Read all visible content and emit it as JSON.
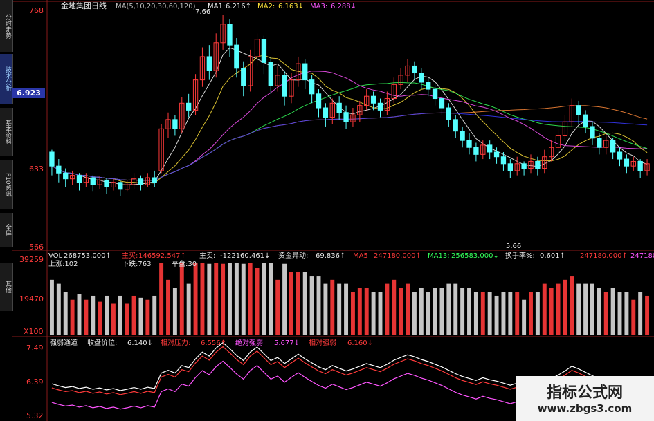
{
  "header": {
    "stock_name": "金地集团日线",
    "ma_params": "MA(5,10,20,30,60,120)",
    "ma1_label": "MA1:",
    "ma1_value": "6.216↑",
    "ma2_label": "MA2:",
    "ma2_value": "6.163↓",
    "ma3_label": "MA3:",
    "ma3_value": "6.288↓"
  },
  "price_axis": {
    "top": "768",
    "current": "6.923",
    "mid": "633",
    "bottom": "566"
  },
  "annotations": {
    "high": "7.66",
    "low": "5.66"
  },
  "side_tabs": [
    "分时走势",
    "技术分析",
    "基本资料",
    "F10资讯",
    "全屏",
    "其他"
  ],
  "volume": {
    "vol_label": "VOL",
    "vol_value": "268753.000↑",
    "main_label": "主买:",
    "main_value": "146592.547↑",
    "main2_label": "主卖:",
    "main2_value": "-122160.461↓",
    "fund_label": "资金异动:",
    "fund_value": "69.836↑",
    "ma5_label": "MA5",
    "ma5_value": "247180.000↑",
    "ma13_label": "MA13:",
    "ma13_value": "256583.000↓",
    "turnover_label": "换手率%:",
    "turnover_value": "0.601↑",
    "extra_value": "247180.000↑",
    "extra2_value": "247180",
    "up_label": "上涨:102",
    "down_label": "下跌:763",
    "flat_label": "平盘:30",
    "axis_top": "39259",
    "axis_mid": "19470",
    "axis_unit": "X100"
  },
  "strength": {
    "title": "强弱通道",
    "close_label": "收盘价位:",
    "close_value": "6.140↓",
    "rel_press_label": "相对压力:",
    "rel_press_value": "6.556↑",
    "abs_strong_label": "绝对强弱",
    "abs_strong_value": "5.677↓",
    "rel_strong_label": "相对强弱",
    "rel_strong_value": "6.160↓",
    "axis_top": "7.49",
    "axis_mid": "6.39",
    "axis_bottom": "5.32"
  },
  "watermark": {
    "line1": "指标公式网",
    "line2": "www.zbgs3.com"
  },
  "colors": {
    "up": "#ff3a3a",
    "down": "#5ff",
    "ma1": "#ffffff",
    "ma2": "#ffe23a",
    "ma3": "#ff55ff",
    "ma4": "#34ff5a",
    "ma5": "#ff8a3a",
    "ma6": "#3a3aff"
  },
  "chart_data": {
    "type": "candlestick",
    "price_range": [
      5.66,
      7.68
    ],
    "candles": [
      [
        6.48,
        6.36,
        6.5,
        6.28
      ],
      [
        6.36,
        6.3,
        6.42,
        6.22
      ],
      [
        6.3,
        6.25,
        6.34,
        6.18
      ],
      [
        6.25,
        6.28,
        6.32,
        6.2
      ],
      [
        6.28,
        6.22,
        6.3,
        6.15
      ],
      [
        6.22,
        6.26,
        6.3,
        6.18
      ],
      [
        6.26,
        6.2,
        6.28,
        6.14
      ],
      [
        6.2,
        6.24,
        6.27,
        6.16
      ],
      [
        6.24,
        6.18,
        6.26,
        6.12
      ],
      [
        6.18,
        6.22,
        6.25,
        6.15
      ],
      [
        6.22,
        6.16,
        6.24,
        6.1
      ],
      [
        6.16,
        6.2,
        6.24,
        6.14
      ],
      [
        6.2,
        6.25,
        6.3,
        6.16
      ],
      [
        6.25,
        6.2,
        6.28,
        6.15
      ],
      [
        6.2,
        6.26,
        6.3,
        6.18
      ],
      [
        6.26,
        6.22,
        6.32,
        6.18
      ],
      [
        6.32,
        6.68,
        6.72,
        6.3
      ],
      [
        6.68,
        6.76,
        6.82,
        6.6
      ],
      [
        6.76,
        6.68,
        6.8,
        6.62
      ],
      [
        6.68,
        6.9,
        6.95,
        6.64
      ],
      [
        6.9,
        6.84,
        6.98,
        6.78
      ],
      [
        6.84,
        7.1,
        7.15,
        6.8
      ],
      [
        7.1,
        7.3,
        7.38,
        7.04
      ],
      [
        7.3,
        7.18,
        7.4,
        7.1
      ],
      [
        7.18,
        7.42,
        7.5,
        7.12
      ],
      [
        7.42,
        7.58,
        7.66,
        7.36
      ],
      [
        7.58,
        7.4,
        7.62,
        7.3
      ],
      [
        7.4,
        7.2,
        7.46,
        7.12
      ],
      [
        7.2,
        7.05,
        7.26,
        6.96
      ],
      [
        7.05,
        7.3,
        7.36,
        7.0
      ],
      [
        7.3,
        7.45,
        7.5,
        7.22
      ],
      [
        7.45,
        7.25,
        7.48,
        7.15
      ],
      [
        7.25,
        7.05,
        7.3,
        6.98
      ],
      [
        7.05,
        7.14,
        7.22,
        7.0
      ],
      [
        7.14,
        6.96,
        7.18,
        6.88
      ],
      [
        6.96,
        7.1,
        7.16,
        6.9
      ],
      [
        7.1,
        7.24,
        7.3,
        7.04
      ],
      [
        7.24,
        7.1,
        7.28,
        7.02
      ],
      [
        7.1,
        6.98,
        7.14,
        6.9
      ],
      [
        6.98,
        6.86,
        7.02,
        6.78
      ],
      [
        6.86,
        6.78,
        6.9,
        6.7
      ],
      [
        6.78,
        6.9,
        6.94,
        6.72
      ],
      [
        6.9,
        6.82,
        6.96,
        6.76
      ],
      [
        6.82,
        6.74,
        6.88,
        6.68
      ],
      [
        6.74,
        6.8,
        6.86,
        6.7
      ],
      [
        6.8,
        6.88,
        6.92,
        6.74
      ],
      [
        6.88,
        6.96,
        7.02,
        6.84
      ],
      [
        6.96,
        6.9,
        7.0,
        6.84
      ],
      [
        6.9,
        6.84,
        6.94,
        6.78
      ],
      [
        6.84,
        6.94,
        7.0,
        6.8
      ],
      [
        6.94,
        7.06,
        7.12,
        6.9
      ],
      [
        7.06,
        7.14,
        7.2,
        7.02
      ],
      [
        7.14,
        7.22,
        7.28,
        7.08
      ],
      [
        7.22,
        7.16,
        7.26,
        7.1
      ],
      [
        7.16,
        7.08,
        7.2,
        7.02
      ],
      [
        7.08,
        7.02,
        7.12,
        6.96
      ],
      [
        7.02,
        6.94,
        7.06,
        6.88
      ],
      [
        6.94,
        6.86,
        6.98,
        6.8
      ],
      [
        6.86,
        6.76,
        6.9,
        6.7
      ],
      [
        6.76,
        6.66,
        6.8,
        6.6
      ],
      [
        6.66,
        6.58,
        6.7,
        6.52
      ],
      [
        6.58,
        6.52,
        6.64,
        6.46
      ],
      [
        6.52,
        6.46,
        6.56,
        6.4
      ],
      [
        6.46,
        6.54,
        6.58,
        6.42
      ],
      [
        6.54,
        6.48,
        6.58,
        6.42
      ],
      [
        6.48,
        6.44,
        6.52,
        6.38
      ],
      [
        6.44,
        6.38,
        6.48,
        6.32
      ],
      [
        6.38,
        6.32,
        6.42,
        6.26
      ],
      [
        6.32,
        6.38,
        6.44,
        6.28
      ],
      [
        6.38,
        6.34,
        6.4,
        6.28
      ],
      [
        6.34,
        6.4,
        6.46,
        6.3
      ],
      [
        6.4,
        6.34,
        6.44,
        6.28
      ],
      [
        6.34,
        6.44,
        6.5,
        6.3
      ],
      [
        6.44,
        6.52,
        6.58,
        6.4
      ],
      [
        6.52,
        6.62,
        6.68,
        6.48
      ],
      [
        6.62,
        6.74,
        6.8,
        6.58
      ],
      [
        6.74,
        6.88,
        6.94,
        6.7
      ],
      [
        6.88,
        6.8,
        6.92,
        6.72
      ],
      [
        6.8,
        6.7,
        6.84,
        6.64
      ],
      [
        6.7,
        6.6,
        6.74,
        6.54
      ],
      [
        6.6,
        6.52,
        6.64,
        6.46
      ],
      [
        6.52,
        6.58,
        6.62,
        6.46
      ],
      [
        6.58,
        6.48,
        6.6,
        6.42
      ],
      [
        6.48,
        6.42,
        6.52,
        6.36
      ],
      [
        6.42,
        6.36,
        6.46,
        6.3
      ],
      [
        6.36,
        6.4,
        6.44,
        6.32
      ],
      [
        6.4,
        6.32,
        6.42,
        6.26
      ],
      [
        6.32,
        6.38,
        6.42,
        6.28
      ]
    ]
  }
}
